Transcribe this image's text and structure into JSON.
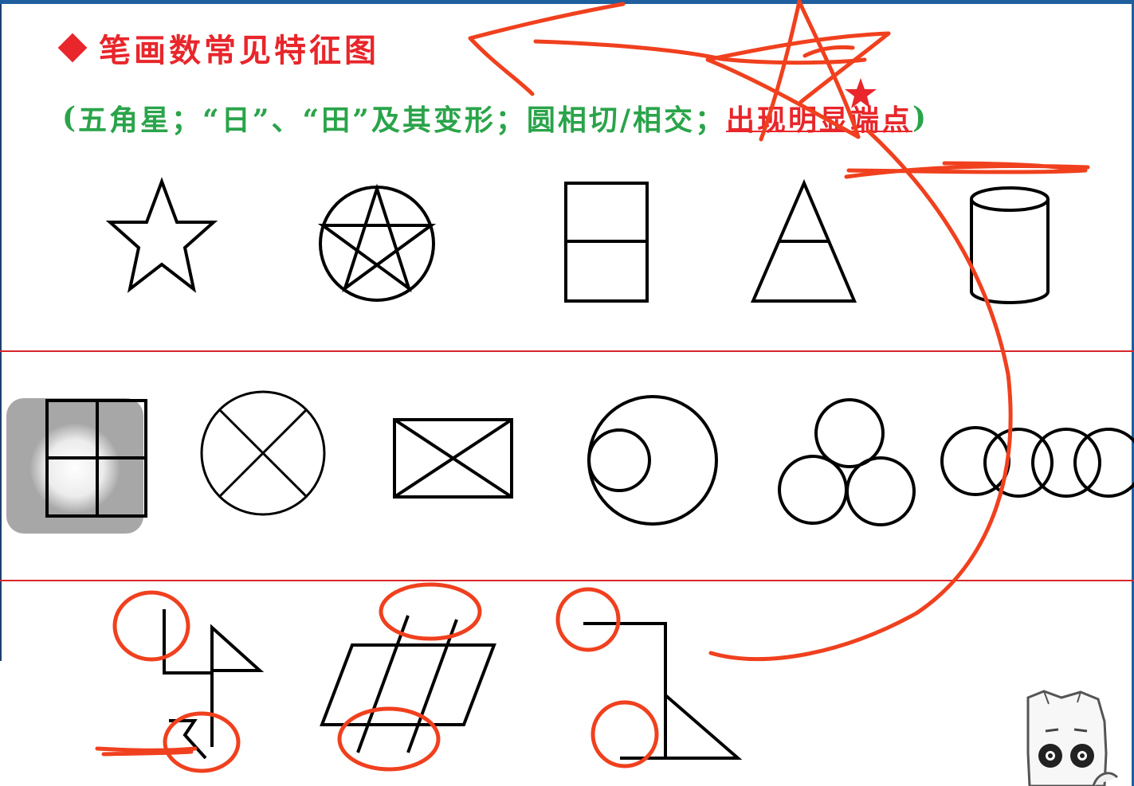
{
  "slide": {
    "title": "笔画数常见特征图",
    "subtitle": {
      "open": "(",
      "main": "五角星；“日”、“田”及其变形；圆相切/相交；",
      "highlight": "出现明显端点",
      "close": ")"
    }
  },
  "figures": {
    "row1": [
      "star",
      "pentagram-in-circle",
      "rectangle-divided",
      "triangle-divided",
      "cylinder"
    ],
    "row2": [
      "tian-grid",
      "circle-with-x",
      "rectangle-with-x",
      "circle-in-circle",
      "three-tangent-circles",
      "four-overlapping-circles"
    ],
    "row3": [
      "flag-with-endpoints",
      "parallelogram-with-lines",
      "hook-with-triangle"
    ]
  },
  "colors": {
    "title": "#e8262b",
    "subtitle": "#2aa44a",
    "annotation": "#f0401e",
    "divider": "#d7262b",
    "frame": "#1f5f9e"
  },
  "overlay": {
    "video_thumbnail": "video-thumbnail",
    "mascot": "cartoon-mascot"
  }
}
